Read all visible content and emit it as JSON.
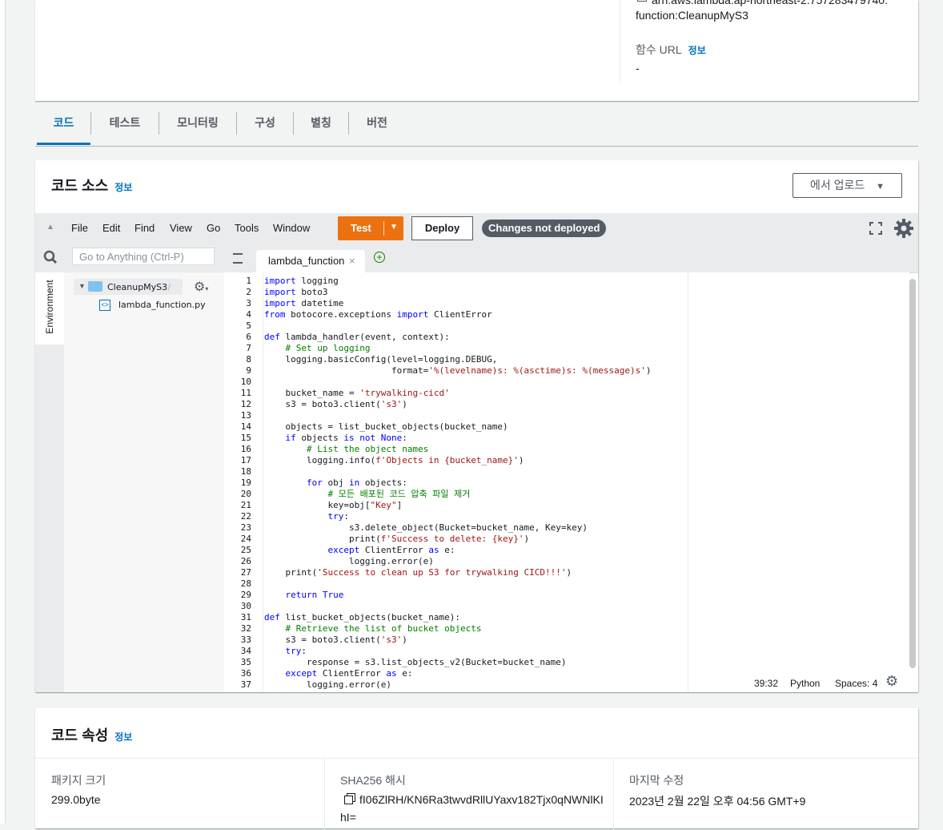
{
  "top": {
    "arn_line1": "arn:aws:lambda:ap-northeast-2:757283479740:",
    "arn_line2": "function:CleanupMyS3",
    "function_url_label": "함수 URL",
    "info": "정보",
    "function_url_value": "-"
  },
  "tabs": [
    "코드",
    "테스트",
    "모니터링",
    "구성",
    "별칭",
    "버전"
  ],
  "code_source": {
    "title": "코드 소스",
    "info": "정보",
    "upload_label": "에서 업로드"
  },
  "menu": [
    "File",
    "Edit",
    "Find",
    "View",
    "Go",
    "Tools",
    "Window"
  ],
  "toolbar": {
    "test_label": "Test",
    "deploy_label": "Deploy",
    "changes_badge": "Changes not deployed"
  },
  "search": {
    "placeholder": "Go to Anything (Ctrl-P)"
  },
  "file_tab": {
    "name": "lambda_function"
  },
  "environment": {
    "label": "Environment",
    "folder": "CleanupMyS3",
    "folder_suffix": "- /",
    "file": "lambda_function.py"
  },
  "code_lines": [
    "import logging",
    "import boto3",
    "import datetime",
    "from botocore.exceptions import ClientError",
    "",
    "def lambda_handler(event, context):",
    "    # Set up logging",
    "    logging.basicConfig(level=logging.DEBUG,",
    "                        format='%(levelname)s: %(asctime)s: %(message)s')",
    "",
    "    bucket_name = 'trywalking-cicd'",
    "    s3 = boto3.client('s3')",
    "",
    "    objects = list_bucket_objects(bucket_name)",
    "    if objects is not None:",
    "        # List the object names",
    "        logging.info(f'Objects in {bucket_name}')",
    "",
    "        for obj in objects:",
    "            # 모든 배포된 코드 압축 파일 제거",
    "            key=obj[\"Key\"]",
    "            try:",
    "                s3.delete_object(Bucket=bucket_name, Key=key)",
    "                print(f'Success to delete: {key}')",
    "            except ClientError as e:",
    "                logging.error(e)",
    "    print('Success to clean up S3 for trywalking CICD!!!')",
    "",
    "    return True",
    "",
    "def list_bucket_objects(bucket_name):",
    "    # Retrieve the list of bucket objects",
    "    s3 = boto3.client('s3')",
    "    try:",
    "        response = s3.list_objects_v2(Bucket=bucket_name)",
    "    except ClientError as e:",
    "        logging.error(e)"
  ],
  "status_bar": {
    "position": "39:32",
    "language": "Python",
    "spaces": "Spaces: 4"
  },
  "code_props": {
    "title": "코드 속성",
    "info": "정보",
    "package_size_label": "패키지 크기",
    "package_size_value": "299.0byte",
    "sha_label": "SHA256 해시",
    "sha_value_line1": "fI06ZlRH/KN6Ra3twvdRllUYaxv182Tjx0qNWNlKI",
    "sha_value_line2": "hI=",
    "modified_label": "마지막 수정",
    "modified_value": "2023년 2월 22일 오후 04:56 GMT+9"
  }
}
